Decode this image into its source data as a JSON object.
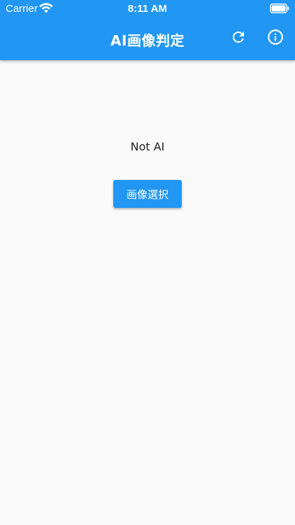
{
  "status_bar": {
    "carrier": "Carrier",
    "time": "8:11 AM",
    "wifi_icon": "wifi-icon",
    "battery_icon": "battery-icon"
  },
  "app_bar": {
    "title": "AI画像判定",
    "background_color": "#2196f3",
    "actions": [
      {
        "icon": "refresh-icon"
      },
      {
        "icon": "info-icon"
      }
    ]
  },
  "main": {
    "result_text": "Not AI",
    "select_button_label": "画像選択",
    "background_color": "#fafafa"
  }
}
